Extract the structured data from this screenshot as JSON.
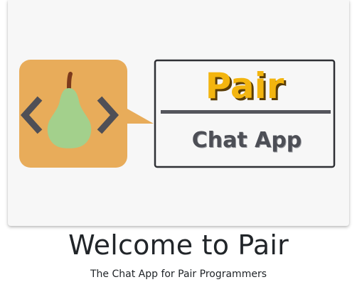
{
  "hero": {
    "logo": {
      "name_text": "Pair",
      "tagline_text": "Chat App",
      "colors": {
        "code_tile": "#e8ac5a",
        "pear": "#a3d08c",
        "stem": "#7b3a1c",
        "brackets": "#4f4f56",
        "name": "#f3b50f",
        "name_shadow": "#5a3d06",
        "divider": "#55565d",
        "tagline": "#4d4f56",
        "frame": "#2f3035"
      }
    }
  },
  "main": {
    "title": "Welcome to Pair",
    "subtitle": "The Chat App for Pair Programmers"
  }
}
